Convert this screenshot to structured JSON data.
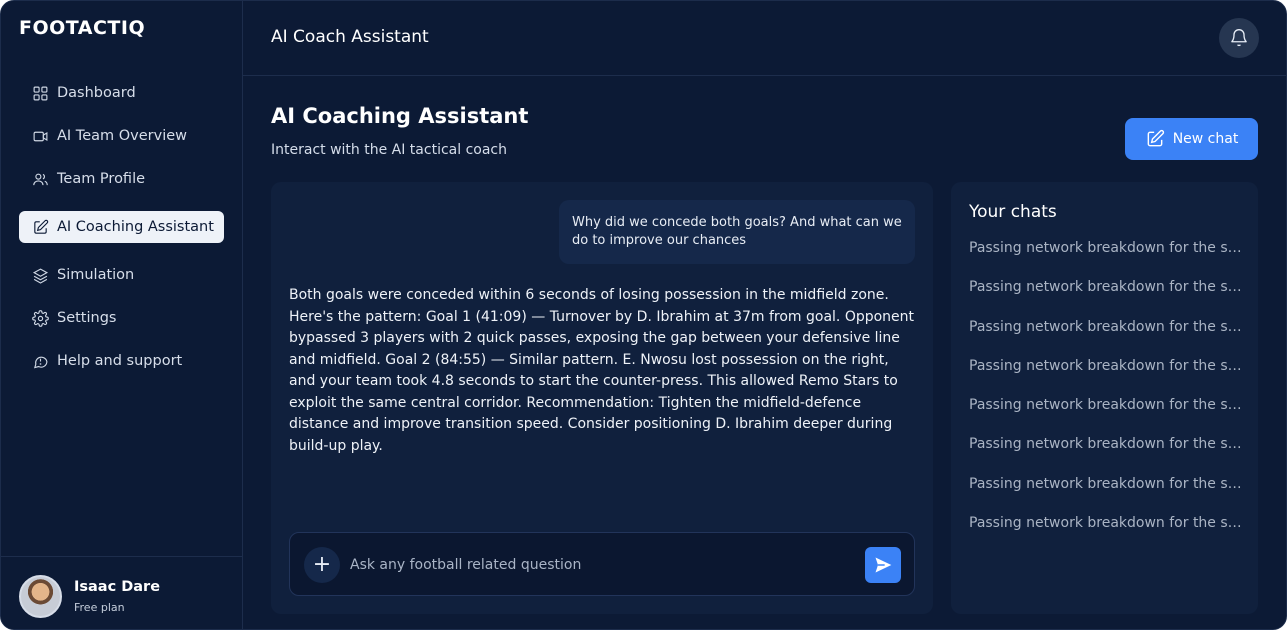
{
  "app": {
    "logo": "FOOTACTIQ"
  },
  "sidebar": {
    "items": [
      {
        "label": "Dashboard",
        "icon": "grid-icon"
      },
      {
        "label": "AI Team Overview",
        "icon": "video-icon"
      },
      {
        "label": "Team Profile",
        "icon": "users-icon"
      },
      {
        "label": "AI Coaching Assistant",
        "icon": "edit-icon",
        "active": true
      },
      {
        "label": "Simulation",
        "icon": "layers-icon"
      },
      {
        "label": "Settings",
        "icon": "gear-icon"
      },
      {
        "label": "Help and support",
        "icon": "help-bubble-icon"
      }
    ],
    "user": {
      "name": "Isaac Dare",
      "plan": "Free plan"
    }
  },
  "header": {
    "title": "AI Coach Assistant",
    "notification_icon": "bell-icon"
  },
  "page": {
    "title": "AI Coaching Assistant",
    "subtitle": "Interact with the AI tactical coach",
    "new_chat_label": "New chat"
  },
  "chat": {
    "user_message": "Why did we concede both goals? And what can we do to improve our chances",
    "ai_message": "Both goals were conceded within 6 seconds of losing possession in the midfield zone. Here's the pattern: Goal 1 (41:09) — Turnover by D. Ibrahim at 37m from goal. Opponent bypassed 3 players with 2 quick passes, exposing the gap between your defensive line and midfield. Goal 2 (84:55) — Similar pattern. E. Nwosu lost possession on the right, and your team took 4.8 seconds to start the counter-press. This allowed Remo Stars to exploit the same central corridor. Recommendation: Tighten the midfield-defence distance and improve transition speed. Consider positioning D. Ibrahim deeper during build-up play.",
    "input_placeholder": "Ask any football related question"
  },
  "chats_panel": {
    "title": "Your chats",
    "items": [
      "Passing network breakdown for the second half",
      "Passing network breakdown for the second half",
      "Passing network breakdown for the second half",
      "Passing network breakdown for the second half",
      "Passing network breakdown for the second half",
      "Passing network breakdown for the second half",
      "Passing network breakdown for the second half",
      "Passing network breakdown for the second half"
    ]
  },
  "colors": {
    "background": "#0c1a35",
    "panel": "#10203d",
    "accent": "#3b82f6"
  }
}
